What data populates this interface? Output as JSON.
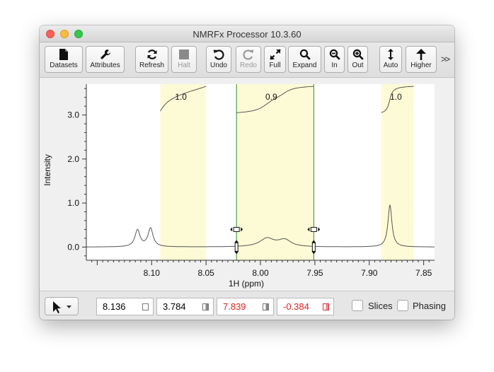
{
  "window": {
    "title": "NMRFx Processor 10.3.60"
  },
  "toolbar": {
    "buttons": [
      {
        "id": "datasets",
        "label": "Datasets",
        "enabled": true
      },
      {
        "id": "attributes",
        "label": "Attributes",
        "enabled": true
      },
      {
        "id": "refresh",
        "label": "Refresh",
        "enabled": true
      },
      {
        "id": "halt",
        "label": "Halt",
        "enabled": false
      },
      {
        "id": "undo",
        "label": "Undo",
        "enabled": true
      },
      {
        "id": "redo",
        "label": "Redo",
        "enabled": false
      },
      {
        "id": "full",
        "label": "Full",
        "enabled": true
      },
      {
        "id": "expand",
        "label": "Expand",
        "enabled": true
      },
      {
        "id": "zoom-in",
        "label": "In",
        "enabled": true
      },
      {
        "id": "zoom-out",
        "label": "Out",
        "enabled": true
      },
      {
        "id": "auto",
        "label": "Auto",
        "enabled": true
      },
      {
        "id": "higher",
        "label": "Higher",
        "enabled": true
      }
    ],
    "overflow_label": ">>"
  },
  "spectrum": {
    "ylabel": "Intensity",
    "xlabel": "1H (ppm)",
    "x_range_ppm": [
      8.16,
      7.84
    ],
    "x_ticks": [
      "8.10",
      "8.05",
      "8.00",
      "7.95",
      "7.90",
      "7.85"
    ],
    "y_ticks": [
      "0.0",
      "1.0",
      "2.0",
      "3.0"
    ],
    "y_range": [
      -0.3,
      3.7
    ],
    "integral_regions": [
      {
        "from_ppm": 8.092,
        "to_ppm": 8.05,
        "value": "1.0",
        "selected": false
      },
      {
        "from_ppm": 8.022,
        "to_ppm": 7.951,
        "value": "0.9",
        "selected": true
      },
      {
        "from_ppm": 7.889,
        "to_ppm": 7.859,
        "value": "1.0",
        "selected": false
      }
    ],
    "region_color": "#fdfbd6",
    "selected_border_color": "#2e8b2e"
  },
  "statusbar": {
    "fields": [
      {
        "value": "8.136",
        "color": "#000000"
      },
      {
        "value": "3.784",
        "color": "#000000"
      },
      {
        "value": "7.839",
        "color": "#e02020"
      },
      {
        "value": "-0.384",
        "color": "#e02020"
      }
    ],
    "slices_label": "Slices",
    "phasing_label": "Phasing",
    "slices_checked": false,
    "phasing_checked": false
  }
}
